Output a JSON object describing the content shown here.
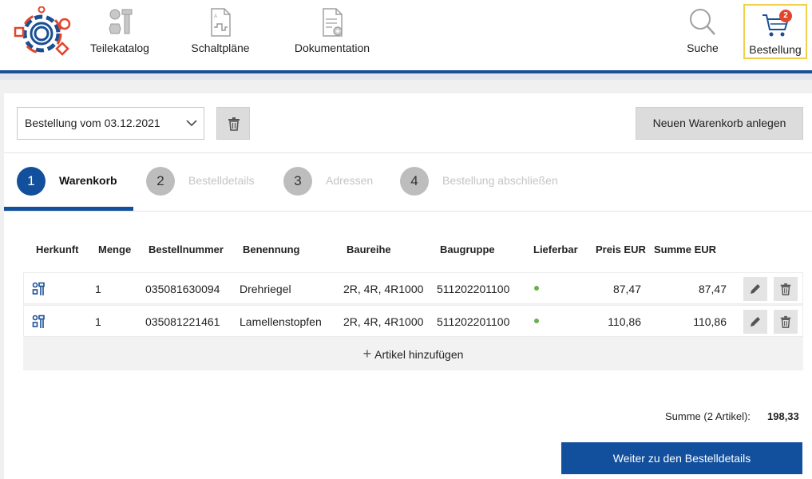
{
  "nav": {
    "parts_catalog": "Teilekatalog",
    "wiring_diagrams": "Schaltpläne",
    "documentation": "Dokumentation",
    "search": "Suche",
    "order": "Bestellung",
    "cart_count": "2"
  },
  "toolbar": {
    "order_select_value": "Bestellung vom 03.12.2021",
    "new_cart_label": "Neuen Warenkorb anlegen"
  },
  "steps": [
    {
      "num": "1",
      "label": "Warenkorb",
      "active": true
    },
    {
      "num": "2",
      "label": "Bestelldetails",
      "active": false
    },
    {
      "num": "3",
      "label": "Adressen",
      "active": false
    },
    {
      "num": "4",
      "label": "Bestellung abschließen",
      "active": false
    }
  ],
  "table": {
    "headers": {
      "origin": "Herkunft",
      "quantity": "Menge",
      "order_number": "Bestellnummer",
      "name": "Benennung",
      "series": "Baureihe",
      "assembly": "Baugruppe",
      "available": "Lieferbar",
      "price": "Preis EUR",
      "total": "Summe EUR"
    },
    "rows": [
      {
        "quantity": "1",
        "order_number": "035081630094",
        "name": "Drehriegel",
        "series": "2R, 4R, 4R1000",
        "assembly": "511202201100",
        "price": "87,47",
        "total": "87,47"
      },
      {
        "quantity": "1",
        "order_number": "035081221461",
        "name": "Lamellenstopfen",
        "series": "2R, 4R, 4R1000",
        "assembly": "511202201100",
        "price": "110,86",
        "total": "110,86"
      }
    ],
    "add_item_label": "Artikel hinzufügen"
  },
  "summary": {
    "label": "Summe (2 Artikel):",
    "value": "198,33"
  },
  "next_button": "Weiter zu den Bestelldetails",
  "colors": {
    "primary": "#124f9c",
    "highlight": "#f2cf4a",
    "available_dot": "#6ab04c",
    "badge": "#e2452b"
  }
}
